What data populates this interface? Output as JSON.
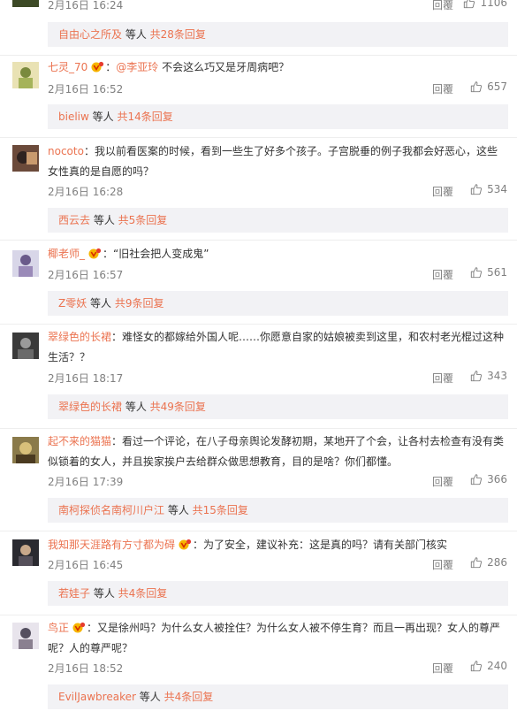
{
  "top": {
    "date": "2月16日 16:24",
    "reply": "回覆",
    "likes": "1106",
    "sub_who": "自由心之所及",
    "sub_mid": " 等人 ",
    "sub_more": "共28条回复"
  },
  "comments": [
    {
      "user": "七灵_70",
      "sep": "：",
      "mention": "@李亚玲",
      "text": " 不会这么巧又是牙周病吧？",
      "date": "2月16日 16:52",
      "reply": "回覆",
      "likes": "657",
      "sub_who": "bieliw",
      "sub_mid": " 等人 ",
      "sub_more": "共14条回复"
    },
    {
      "user": "nocoto",
      "sep": "：",
      "text": "我以前看医案的时候，看到一些生了好多个孩子。子宫脱垂的例子我都会好恶心，这些女性真的是自愿的吗？",
      "date": "2月16日 16:28",
      "reply": "回覆",
      "likes": "534",
      "sub_who": "西云去",
      "sub_mid": " 等人 ",
      "sub_more": "共5条回复"
    },
    {
      "user": "椰老师_",
      "sep": "：",
      "text": "“旧社会把人变成鬼”",
      "date": "2月16日 16:57",
      "reply": "回覆",
      "likes": "561",
      "sub_who": "Z零妖",
      "sub_mid": " 等人 ",
      "sub_more": "共9条回复"
    },
    {
      "user": "翠绿色的长裙",
      "sep": "：",
      "text": "难怪女的都嫁给外国人呢……你愿意自家的姑娘被卖到这里，和农村老光棍过这种生活？？",
      "date": "2月16日 18:17",
      "reply": "回覆",
      "likes": "343",
      "sub_who": "翠绿色的长裙",
      "sub_mid": " 等人 ",
      "sub_more": "共49条回复"
    },
    {
      "user": "起不来的猫猫",
      "sep": "：",
      "text": "看过一个评论，在八子母亲舆论发酵初期，某地开了个会，让各村去检查有没有类似锁着的女人，并且挨家挨户去给群众做思想教育，目的是啥？你们都懂。",
      "date": "2月16日 17:39",
      "reply": "回覆",
      "likes": "366",
      "sub_who": "南柯探侦名南柯川户江",
      "sub_mid": " 等人 ",
      "sub_more": "共15条回复"
    },
    {
      "user": "我知那天涯路有方寸都为碍",
      "sep": "：",
      "text": "为了安全，建议补充：这是真的吗？请有关部门核实",
      "date": "2月16日 16:45",
      "reply": "回覆",
      "likes": "286",
      "sub_who": "若娃子",
      "sub_mid": " 等人 ",
      "sub_more": "共4条回复"
    },
    {
      "user": "鸟正",
      "sep": "：",
      "text": "又是徐州吗？为什么女人被拴住？为什么女人被不停生育？而且一再出现？女人的尊严呢？人的尊严呢？",
      "date": "2月16日 18:52",
      "reply": "回覆",
      "likes": "240",
      "sub_who": "EvilJawbreaker",
      "sub_mid": " 等人 ",
      "sub_more": "共4条回复"
    }
  ],
  "colors": {
    "accent": "#eb7350",
    "muted": "#808080",
    "sub_bg": "#f2f2f5"
  },
  "icons": {
    "like": "thumbs-up-icon",
    "badge": "vip-badge-icon"
  }
}
